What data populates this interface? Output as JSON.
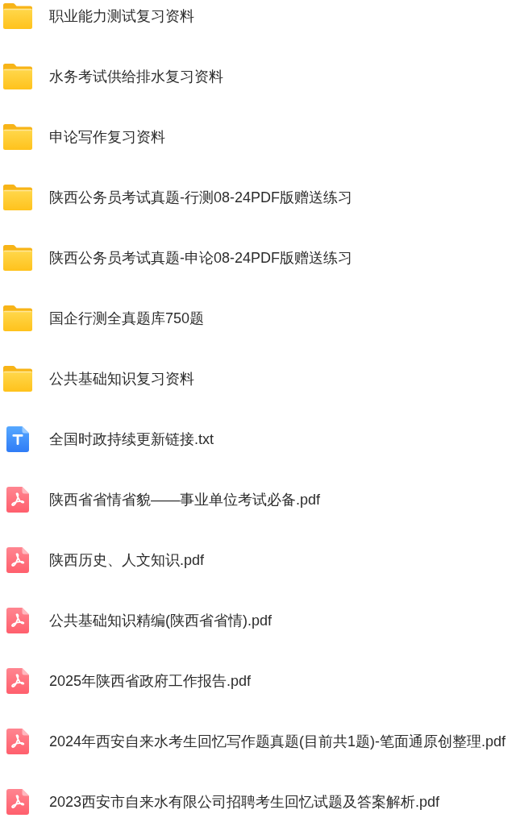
{
  "files": [
    {
      "kind": "folder",
      "name": "职业能力测试复习资料"
    },
    {
      "kind": "folder",
      "name": "水务考试供给排水复习资料"
    },
    {
      "kind": "folder",
      "name": "申论写作复习资料"
    },
    {
      "kind": "folder",
      "name": "陕西公务员考试真题-行测08-24PDF版赠送练习"
    },
    {
      "kind": "folder",
      "name": "陕西公务员考试真题-申论08-24PDF版赠送练习"
    },
    {
      "kind": "folder",
      "name": "国企行测全真题库750题"
    },
    {
      "kind": "folder",
      "name": "公共基础知识复习资料"
    },
    {
      "kind": "txt",
      "name": "全国时政持续更新链接.txt"
    },
    {
      "kind": "pdf",
      "name": "陕西省省情省貌——事业单位考试必备.pdf"
    },
    {
      "kind": "pdf",
      "name": "陕西历史、人文知识.pdf"
    },
    {
      "kind": "pdf",
      "name": "公共基础知识精编(陕西省省情).pdf"
    },
    {
      "kind": "pdf",
      "name": "2025年陕西省政府工作报告.pdf"
    },
    {
      "kind": "pdf",
      "name": "2024年西安自来水考生回忆写作题真题(目前共1题)-笔面通原创整理.pdf"
    },
    {
      "kind": "pdf",
      "name": "2023西安市自来水有限公司招聘考生回忆试题及答案解析.pdf"
    }
  ]
}
